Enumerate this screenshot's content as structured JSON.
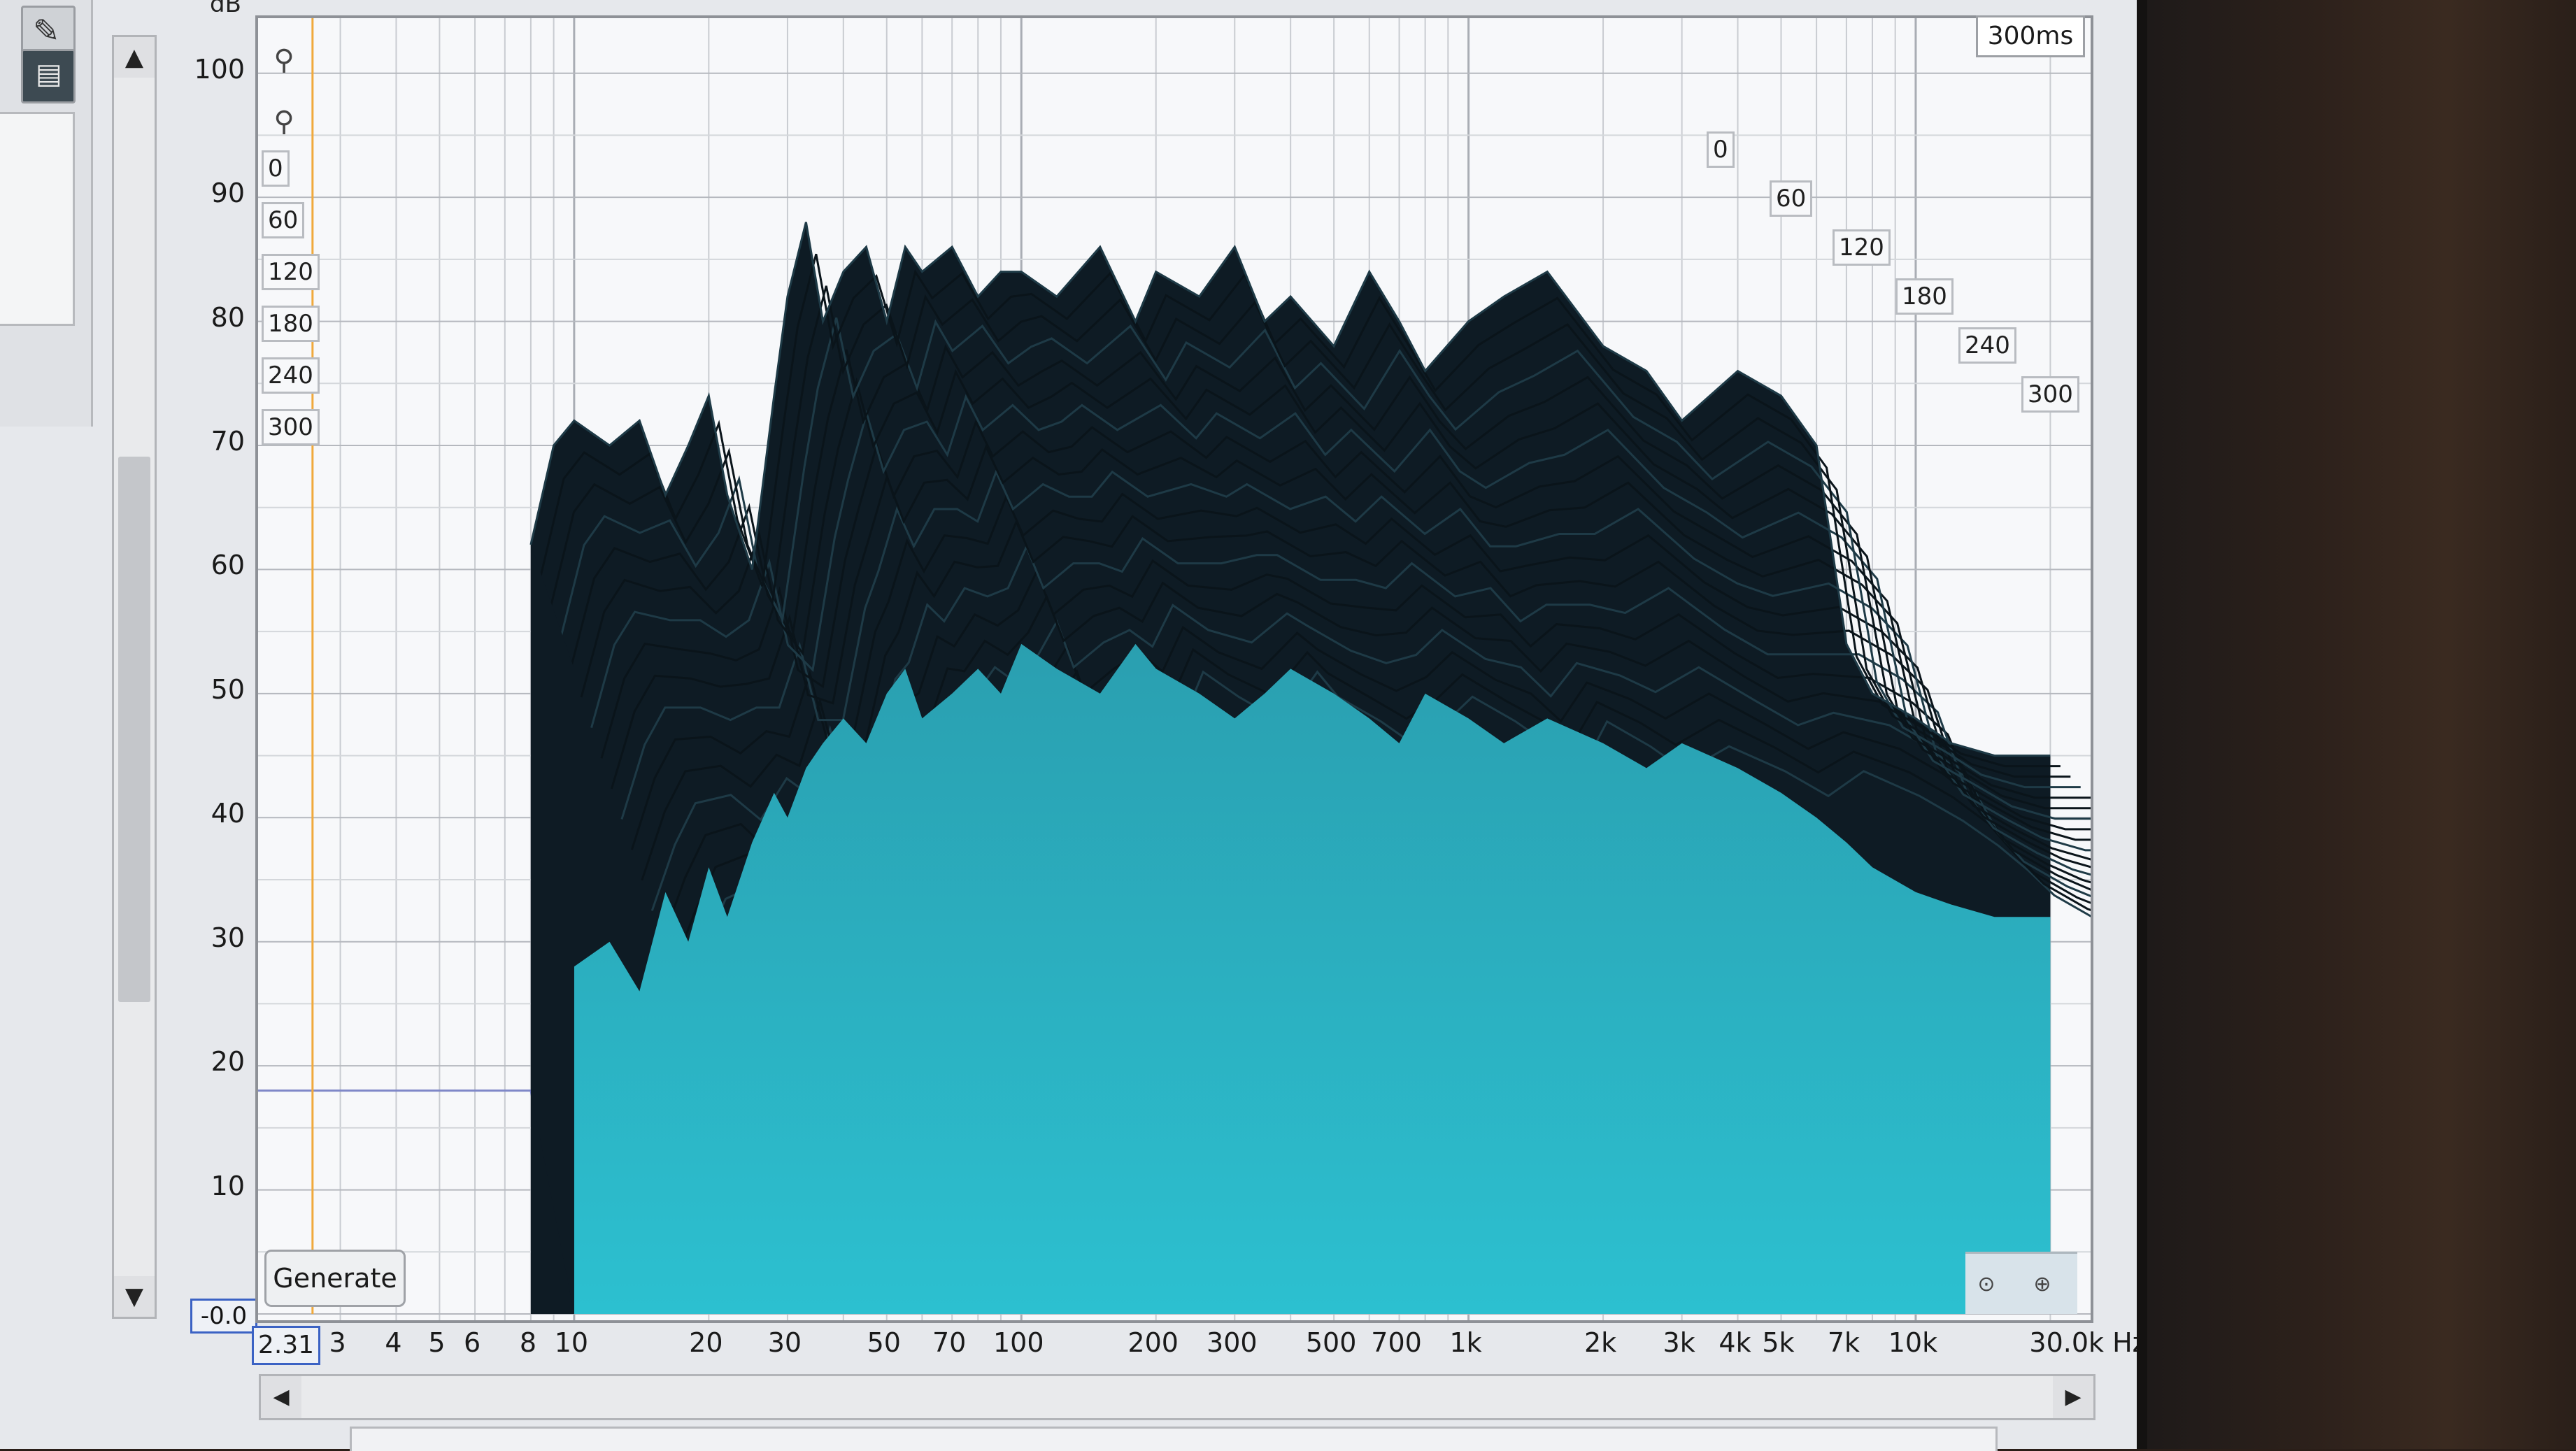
{
  "chart_data": {
    "type": "area",
    "title": "",
    "xlabel": "Hz",
    "ylabel": "dB",
    "xscale": "log",
    "xlim": [
      2.31,
      30000
    ],
    "ylim": [
      -0.0,
      105
    ],
    "grid": true,
    "x_tick_labels": [
      "2.31",
      "3",
      "4",
      "5",
      "6",
      "8",
      "10",
      "20",
      "30",
      "50",
      "70",
      "100",
      "200",
      "300",
      "500",
      "700",
      "1k",
      "2k",
      "3k",
      "4k",
      "5k",
      "7k",
      "10k",
      "30.0k Hz"
    ],
    "y_tick_labels": [
      "100",
      "90",
      "80",
      "70",
      "60",
      "50",
      "40",
      "30",
      "20",
      "10"
    ],
    "y_min_label": "-0.0",
    "y_unit_label": "dB",
    "time_slices_ms_depth": [
      "0",
      "60",
      "120",
      "180",
      "240",
      "300"
    ],
    "time_slices_ms_side": [
      "0",
      "60",
      "120",
      "180",
      "240",
      "300"
    ],
    "time_range_label": "300ms",
    "front_slice_series": {
      "name": "",
      "x": [
        8,
        9,
        10,
        12,
        14,
        16,
        18,
        20,
        22,
        25,
        28,
        30,
        33,
        36,
        40,
        45,
        50,
        55,
        60,
        70,
        80,
        90,
        100,
        120,
        150,
        180,
        200,
        250,
        300,
        350,
        400,
        500,
        600,
        700,
        800,
        1000,
        1200,
        1500,
        2000,
        2500,
        3000,
        4000,
        5000,
        6000,
        7000,
        8000,
        10000,
        12000,
        15000,
        20000
      ],
      "y": [
        62,
        70,
        72,
        70,
        72,
        66,
        70,
        74,
        66,
        60,
        74,
        82,
        88,
        80,
        84,
        86,
        80,
        86,
        84,
        86,
        82,
        84,
        84,
        82,
        86,
        80,
        84,
        82,
        86,
        80,
        82,
        78,
        84,
        80,
        76,
        80,
        82,
        84,
        78,
        76,
        72,
        76,
        74,
        70,
        54,
        50,
        48,
        46,
        45,
        45
      ]
    },
    "late_slice_series": {
      "name": "",
      "x": [
        8,
        9,
        10,
        12,
        14,
        16,
        18,
        20,
        22,
        25,
        28,
        30,
        33,
        36,
        40,
        45,
        50,
        55,
        60,
        70,
        80,
        90,
        100,
        120,
        150,
        180,
        200,
        250,
        300,
        350,
        400,
        500,
        600,
        700,
        800,
        1000,
        1200,
        1500,
        2000,
        2500,
        3000,
        4000,
        5000,
        6000,
        7000,
        8000,
        10000,
        12000,
        15000,
        20000
      ],
      "y": [
        20,
        24,
        28,
        30,
        26,
        34,
        30,
        36,
        32,
        38,
        42,
        40,
        44,
        46,
        48,
        46,
        50,
        52,
        48,
        50,
        52,
        50,
        54,
        52,
        50,
        54,
        52,
        50,
        48,
        50,
        52,
        50,
        48,
        46,
        50,
        48,
        46,
        48,
        46,
        44,
        46,
        44,
        42,
        40,
        38,
        36,
        34,
        33,
        32,
        32
      ]
    },
    "fill_color": "#29b3c4",
    "ridge_color": "#0c1a22"
  },
  "controls": {
    "generate_label": "Generate",
    "x_start_value": "2.31",
    "scroll_up": "▲",
    "scroll_down": "▼",
    "scroll_left": "◀",
    "scroll_right": "▶"
  }
}
